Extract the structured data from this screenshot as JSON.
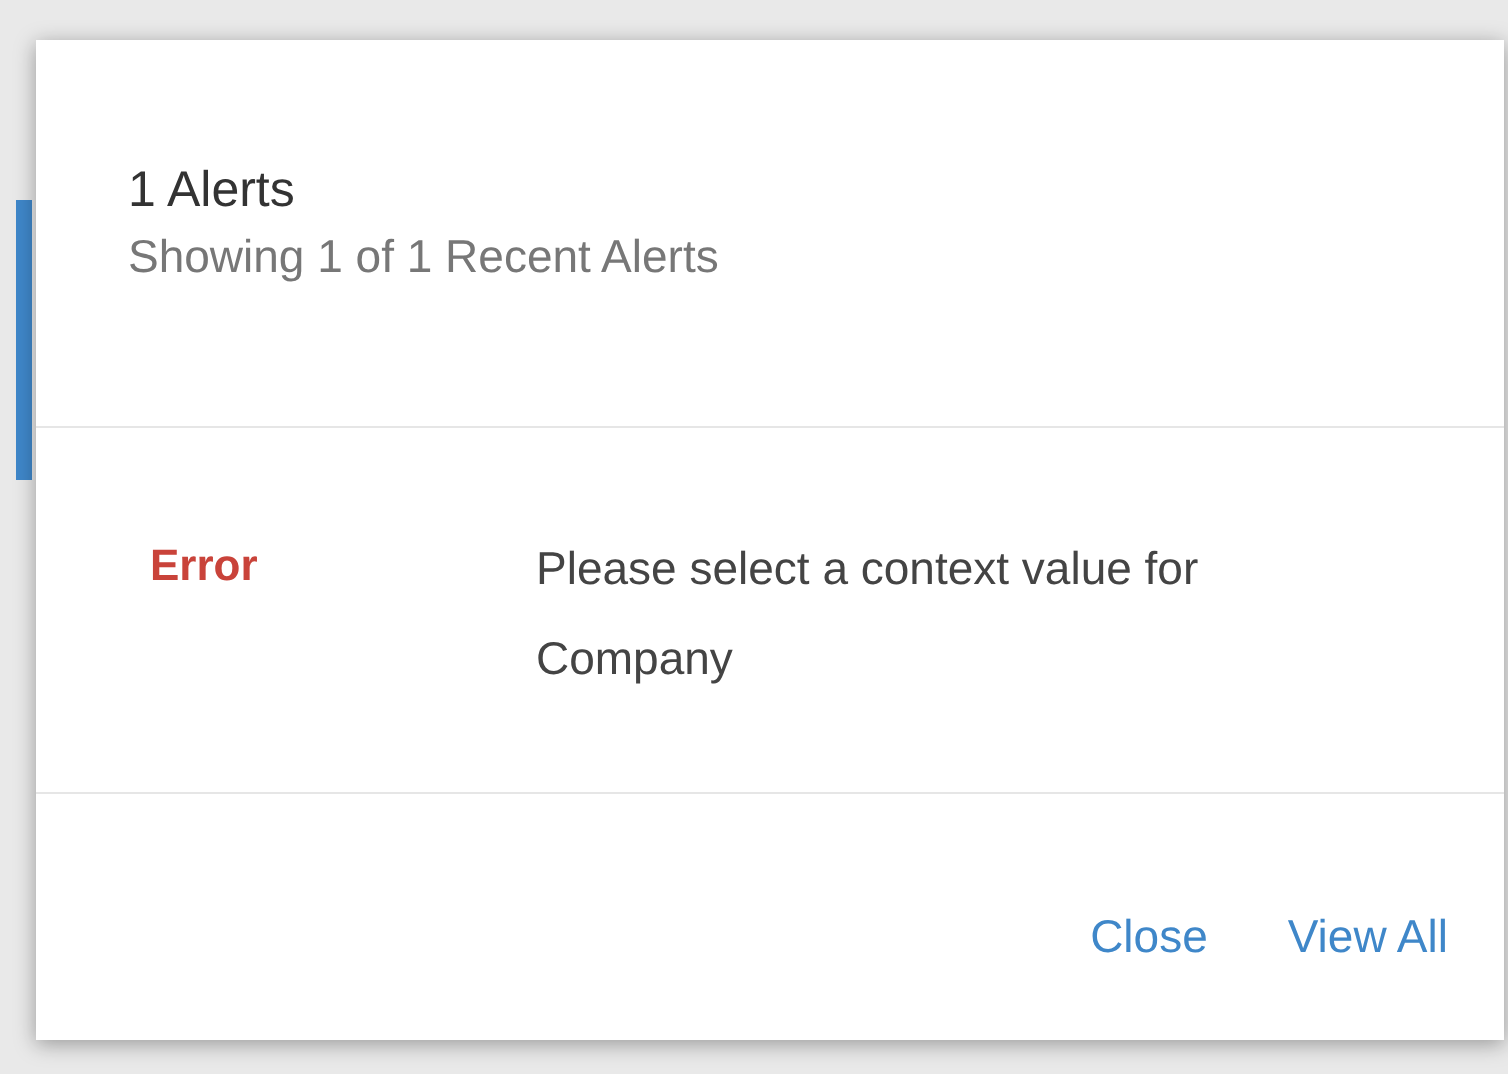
{
  "header": {
    "title": "1 Alerts",
    "subtitle": "Showing 1 of 1 Recent Alerts"
  },
  "alerts": [
    {
      "kind": "error",
      "severity": "Error",
      "message": "Please select a context value for Company"
    }
  ],
  "buttons": [
    "Close",
    "View All"
  ]
}
